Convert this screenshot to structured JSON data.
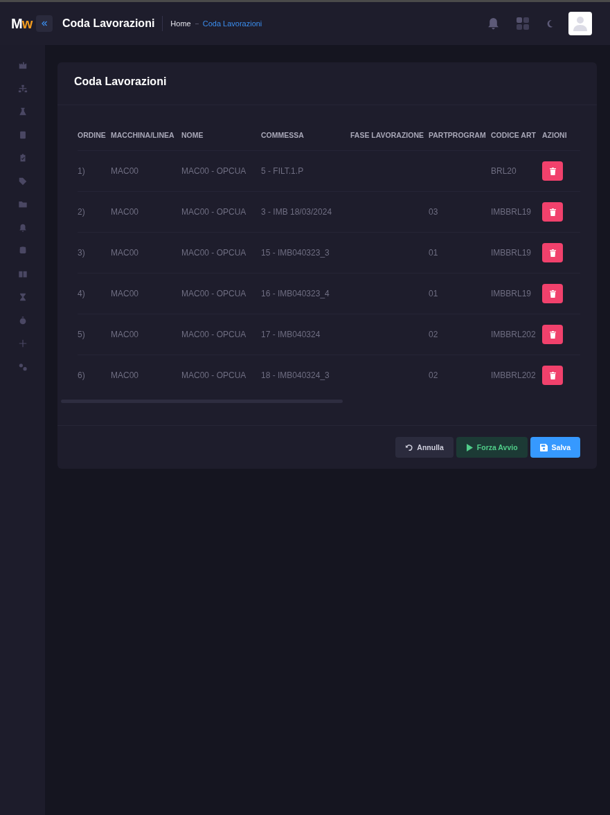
{
  "header": {
    "logo": "Mw",
    "title": "Coda Lavorazioni",
    "breadcrumb": [
      "Home",
      "Coda Lavorazioni"
    ]
  },
  "card": {
    "title": "Coda Lavorazioni",
    "table": {
      "columns": [
        "ORDINE",
        "MACCHINA/LINEA",
        "NOME",
        "COMMESSA",
        "FASE LAVORAZIONE",
        "PARTPROGRAM",
        "CODICE ART",
        "AZIONI"
      ],
      "rows": [
        {
          "cells": [
            "1)",
            "MAC00",
            "MAC00 - OPCUA",
            "5 - FILT.1.P",
            "",
            "",
            "BRL20"
          ]
        },
        {
          "cells": [
            "2)",
            "MAC00",
            "MAC00 - OPCUA",
            "3 - IMB 18/03/2024",
            "",
            "03",
            "IMBBRL19"
          ]
        },
        {
          "cells": [
            "3)",
            "MAC00",
            "MAC00 - OPCUA",
            "15 - IMB040323_3",
            "",
            "01",
            "IMBBRL19"
          ]
        },
        {
          "cells": [
            "4)",
            "MAC00",
            "MAC00 - OPCUA",
            "16 - IMB040323_4",
            "",
            "01",
            "IMBBRL19"
          ]
        },
        {
          "cells": [
            "5)",
            "MAC00",
            "MAC00 - OPCUA",
            "17 - IMB040324",
            "",
            "02",
            "IMBBRL202"
          ]
        },
        {
          "cells": [
            "6)",
            "MAC00",
            "MAC00 - OPCUA",
            "18 - IMB040324_3",
            "",
            "02",
            "IMBBRL202"
          ]
        }
      ]
    },
    "buttons": [
      {
        "kind": "cancel",
        "label": "Annulla"
      },
      {
        "kind": "start",
        "label": "Forza Avvio"
      },
      {
        "kind": "save",
        "label": "Salva"
      }
    ]
  }
}
